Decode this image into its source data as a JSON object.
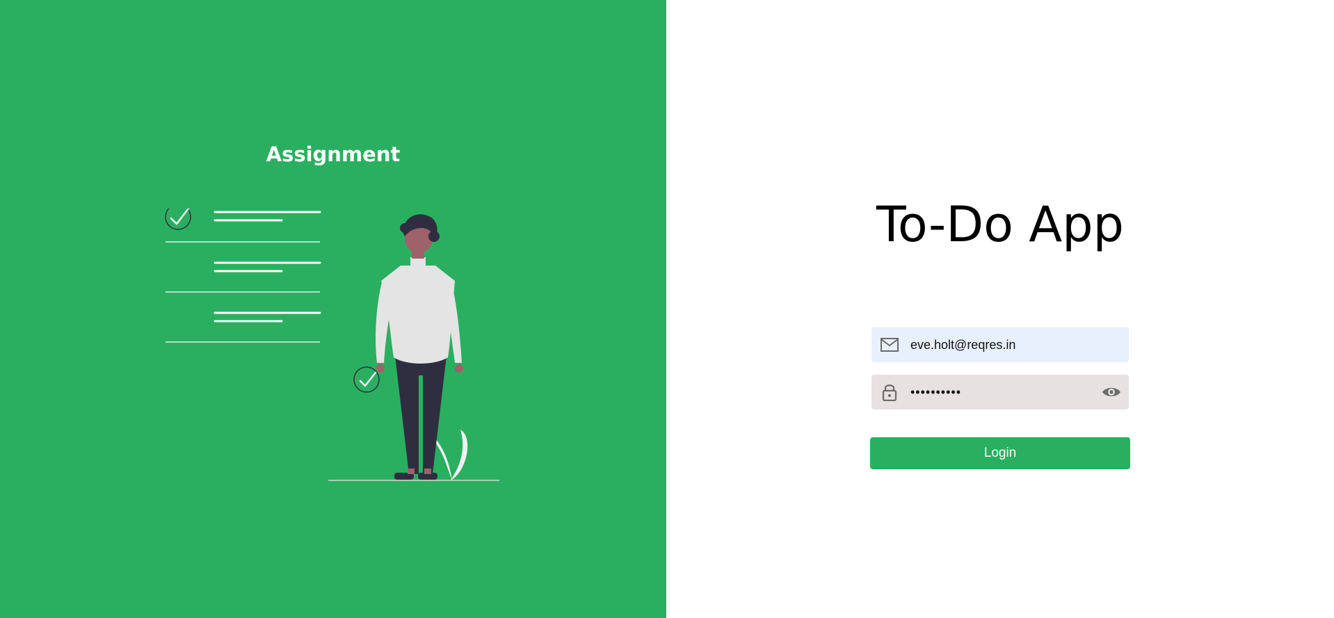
{
  "left_panel": {
    "title": "Assignment",
    "background_color": "#2aaf60"
  },
  "app": {
    "title": "To-Do App"
  },
  "email": {
    "value": "eve.holt@reqres.in",
    "icon": "mail-icon"
  },
  "password": {
    "value": "cityslicka",
    "icon": "lock-icon",
    "toggle_icon": "eye-icon"
  },
  "login": {
    "label": "Login",
    "color": "#2aaf60"
  }
}
